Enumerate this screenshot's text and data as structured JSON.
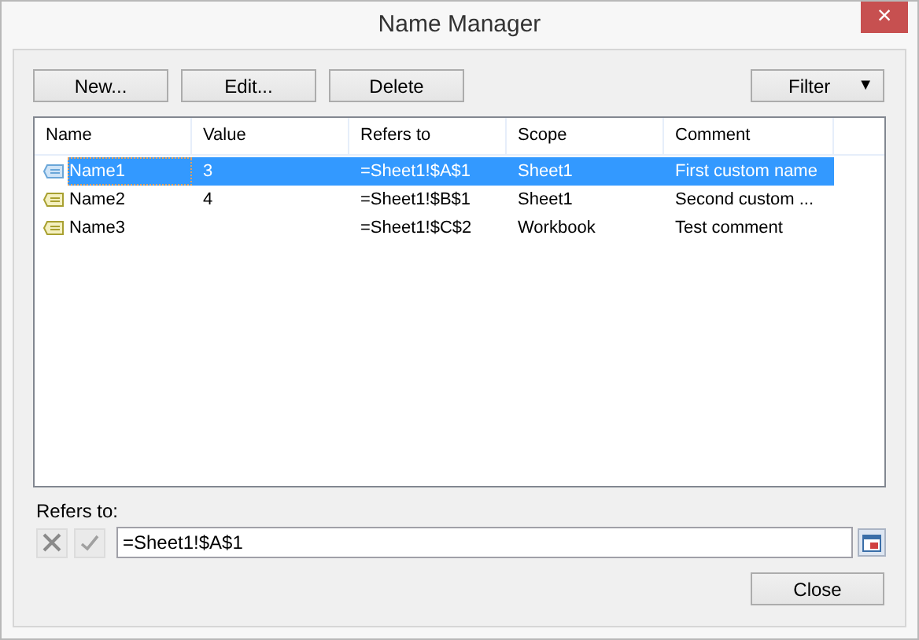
{
  "window": {
    "title": "Name Manager",
    "close": "×"
  },
  "toolbar": [
    "New...",
    "Edit...",
    "Delete"
  ],
  "filter": {
    "label": "Filter",
    "arrow": "▼"
  },
  "table": {
    "columns": [
      "Name",
      "Value",
      "Refers to",
      "Scope",
      "Comment"
    ],
    "rows": [
      {
        "cells": [
          "Name1",
          "3",
          "=Sheet1!$A$1",
          "Sheet1",
          "First custom name"
        ],
        "selected": true
      },
      {
        "cells": [
          "Name2",
          "4",
          "=Sheet1!$B$1",
          "Sheet1",
          "Second custom ..."
        ],
        "selected": false
      },
      {
        "cells": [
          "Name3",
          "",
          "=Sheet1!$C$2",
          "Workbook",
          "Test comment"
        ],
        "selected": false
      }
    ]
  },
  "refers_to": {
    "label": "Refers to:",
    "value": "=Sheet1!$A$1"
  },
  "close_button": "Close"
}
